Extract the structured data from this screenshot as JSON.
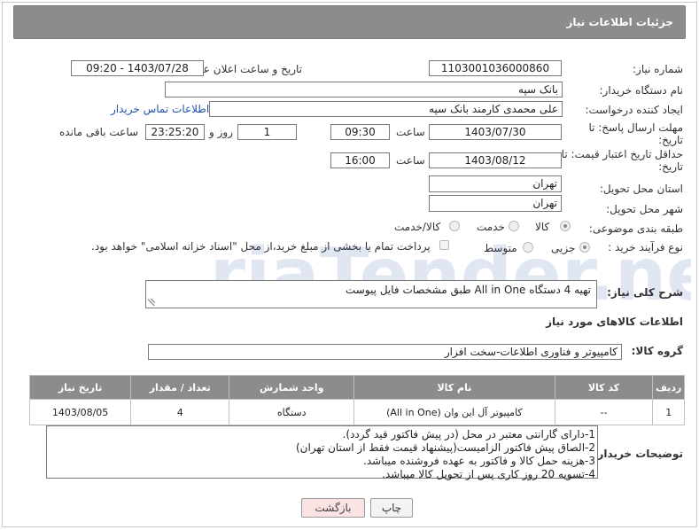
{
  "header": {
    "title": "جزئیات اطلاعات نیاز"
  },
  "fields": {
    "need_number_label": "شماره نیاز:",
    "need_number": "1103001036000860",
    "announce_label": "تاریخ و ساعت اعلان عمومی:",
    "announce_value": "1403/07/28 - 09:20",
    "buyer_org_label": "نام دستگاه خریدار:",
    "buyer_org": "بانک سپه",
    "creator_label": "ایجاد کننده درخواست:",
    "creator": "علی محمدی کارمند بانک سپه",
    "contact_link": "اطلاعات تماس خریدار",
    "deadline_label_1": "مهلت ارسال پاسخ: تا",
    "deadline_label_2": "تاریخ:",
    "deadline_date": "1403/07/30",
    "time_label": "ساعت",
    "deadline_time": "09:30",
    "days_value": "1",
    "days_label": "روز و",
    "remaining_time": "23:25:20",
    "remaining_label": "ساعت باقی مانده",
    "validity_label_1": "حداقل تاریخ اعتبار قیمت: تا",
    "validity_label_2": "تاریخ:",
    "validity_date": "1403/08/12",
    "validity_time": "16:00",
    "province_label": "استان محل تحویل:",
    "province": "تهران",
    "city_label": "شهر محل تحویل:",
    "city": "تهران",
    "category_label": "طبقه بندی موضوعی:",
    "category_options": [
      "کالا",
      "خدمت",
      "کالا/خدمت"
    ],
    "purchase_label": "نوع فرآیند خرید :",
    "purchase_options": [
      "جزیی",
      "متوسط"
    ],
    "payment_note": "پرداخت تمام یا بخشی از مبلغ خرید،از محل \"اسناد خزانه اسلامی\" خواهد بود."
  },
  "description": {
    "label": "شرح کلی نیاز:",
    "text": "تهیه 4 دستگاه All in One  طبق مشخصات فایل پیوست"
  },
  "goods_info": {
    "title": "اطلاعات کالاهای مورد نیاز",
    "group_label": "گروه کالا:",
    "group_value": "کامپیوتر و فناوری اطلاعات-سخت افزار"
  },
  "table": {
    "headers": [
      "ردیف",
      "کد کالا",
      "نام کالا",
      "واحد شمارش",
      "تعداد / مقدار",
      "تاریخ نیاز"
    ],
    "rows": [
      [
        "1",
        "--",
        "کامپیوتر آل این وان (All in One)",
        "دستگاه",
        "4",
        "1403/08/05"
      ]
    ]
  },
  "buyer_notes": {
    "label": "توضیحات خریدار:",
    "lines": [
      "1-دارای گارانتی معتبر در محل (در پیش فاکتور قید گردد).",
      "2-الصاق پیش فاکتور الزامیست(پیشنهاد قیمت فقط از استان تهران)",
      "3-هزینه حمل کالا و فاکتور به عهده فروشنده میباشد.",
      "4-تسویه 20 روز کاری پس از تحویل کالا میباشد."
    ]
  },
  "buttons": {
    "print": "چاپ",
    "back": "بازگشت"
  },
  "watermark": {
    "text": "AriaTender.net"
  },
  "colors": {
    "header_bg": "#8c8c8c",
    "link": "#2155a8",
    "back_btn_bg": "#fbe3e3"
  }
}
